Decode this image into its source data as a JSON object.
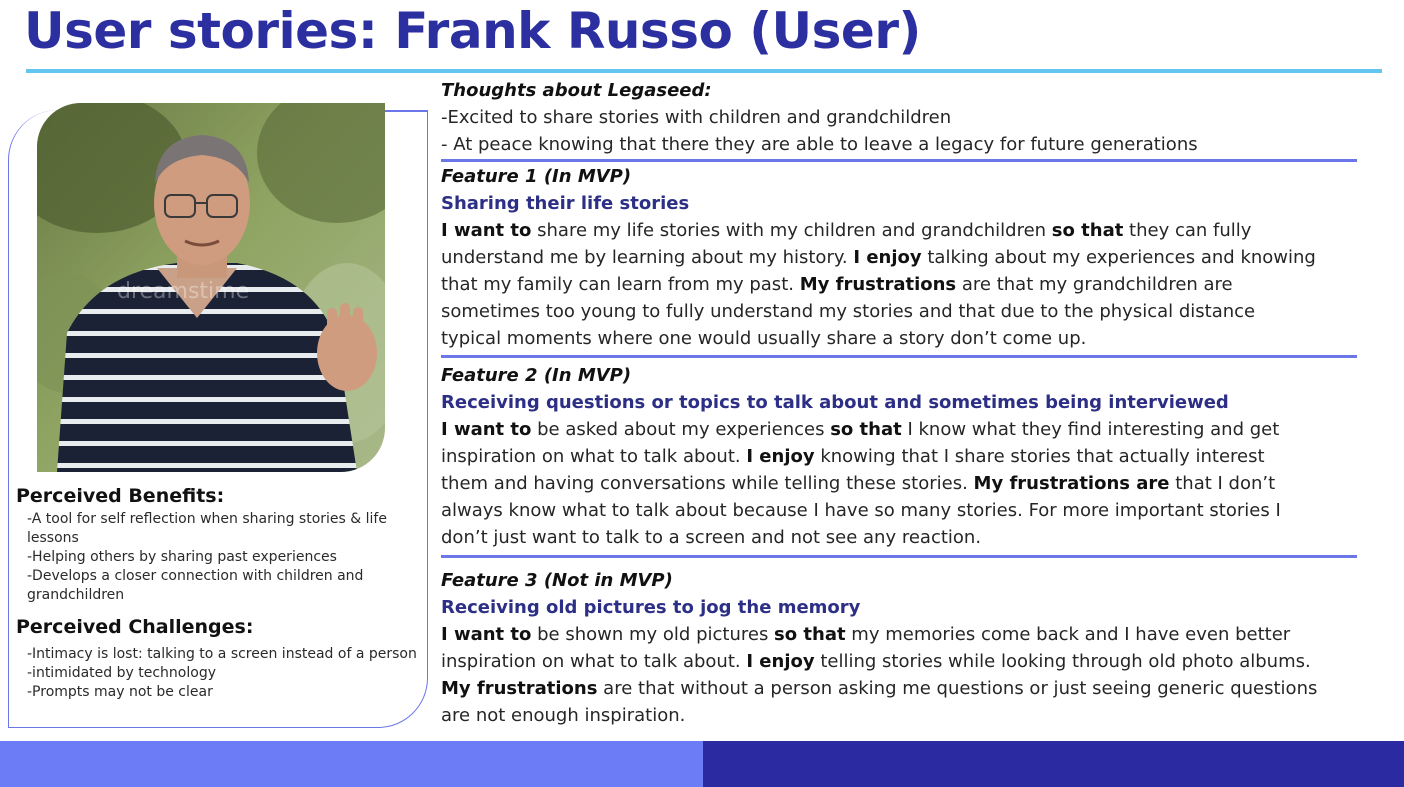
{
  "title": "User stories: Frank Russo (User)",
  "photo": {
    "alt": "Elderly man in a striped polo shirt",
    "watermark": "dreamstime"
  },
  "benefits": {
    "heading": "Perceived Benefits:",
    "items": [
      "-A tool for self reflection when sharing stories & life lessons",
      "-Helping others by sharing past experiences",
      "-Develops a closer connection with children and grandchildren"
    ]
  },
  "challenges": {
    "heading": "Perceived Challenges:",
    "items": [
      "-Intimacy is lost: talking to a screen instead of a person",
      "-intimidated by technology",
      "-Prompts may not be clear"
    ]
  },
  "thoughts": {
    "heading": "Thoughts about Legaseed:",
    "lines": [
      "-Excited to share stories with children and grandchildren",
      "- At peace knowing that there they are able to leave a legacy for future generations"
    ]
  },
  "features": [
    {
      "heading": "Feature 1 (In MVP)",
      "subtitle": "Sharing their life stories",
      "lines": [
        [
          {
            "b": "I want to"
          },
          {
            "t": " share my life stories with my children and grandchildren "
          },
          {
            "b": "so that"
          },
          {
            "t": " they can fully"
          }
        ],
        [
          {
            "t": "understand me by learning about my history. "
          },
          {
            "b": "I enjoy"
          },
          {
            "t": " talking about my experiences and knowing"
          }
        ],
        [
          {
            "t": "that my family can learn from my past. "
          },
          {
            "b": "My frustrations"
          },
          {
            "t": " are that my grandchildren are"
          }
        ],
        [
          {
            "t": "sometimes too young to fully understand my stories and that due to the physical distance"
          }
        ],
        [
          {
            "t": "typical moments where one would usually share a story don’t come up."
          }
        ]
      ]
    },
    {
      "heading": "Feature 2 (In MVP)",
      "subtitle": "Receiving questions or topics to talk about and sometimes being interviewed",
      "lines": [
        [
          {
            "b": "I want to"
          },
          {
            "t": " be asked about my experiences "
          },
          {
            "b": "so that"
          },
          {
            "t": " I know what they find interesting and get"
          }
        ],
        [
          {
            "t": "inspiration on what to talk about. "
          },
          {
            "b": "I enjoy"
          },
          {
            "t": " knowing that I share stories that actually interest"
          }
        ],
        [
          {
            "t": "them and having conversations while telling these stories. "
          },
          {
            "b": "My frustrations are"
          },
          {
            "t": " that I don’t"
          }
        ],
        [
          {
            "t": "always know what to talk about because I have so many stories. For more important stories I"
          }
        ],
        [
          {
            "t": "don’t just want to talk to a screen and not see any reaction."
          }
        ]
      ]
    },
    {
      "heading": "Feature 3 (Not in MVP)",
      "subtitle": "Receiving old pictures to jog the memory",
      "lines": [
        [
          {
            "b": "I want to"
          },
          {
            "t": " be shown my old pictures "
          },
          {
            "b": "so that"
          },
          {
            "t": " my memories come back and I have even better"
          }
        ],
        [
          {
            "t": "inspiration on what to talk about. "
          },
          {
            "b": "I enjoy"
          },
          {
            "t": " telling stories while looking through old photo albums."
          }
        ],
        [
          {
            "b": "My frustrations"
          },
          {
            "t": " are that without a person asking me questions or just seeing generic questions"
          }
        ],
        [
          {
            "t": "are not enough inspiration."
          }
        ]
      ]
    }
  ],
  "colors": {
    "title": "#2c2fa0",
    "title_rule": "#62c6f0",
    "subtitle": "#2c2f85",
    "divider": "#6b76e8",
    "footer_left": "#6b7cf6",
    "footer_right": "#2b2aa0"
  }
}
